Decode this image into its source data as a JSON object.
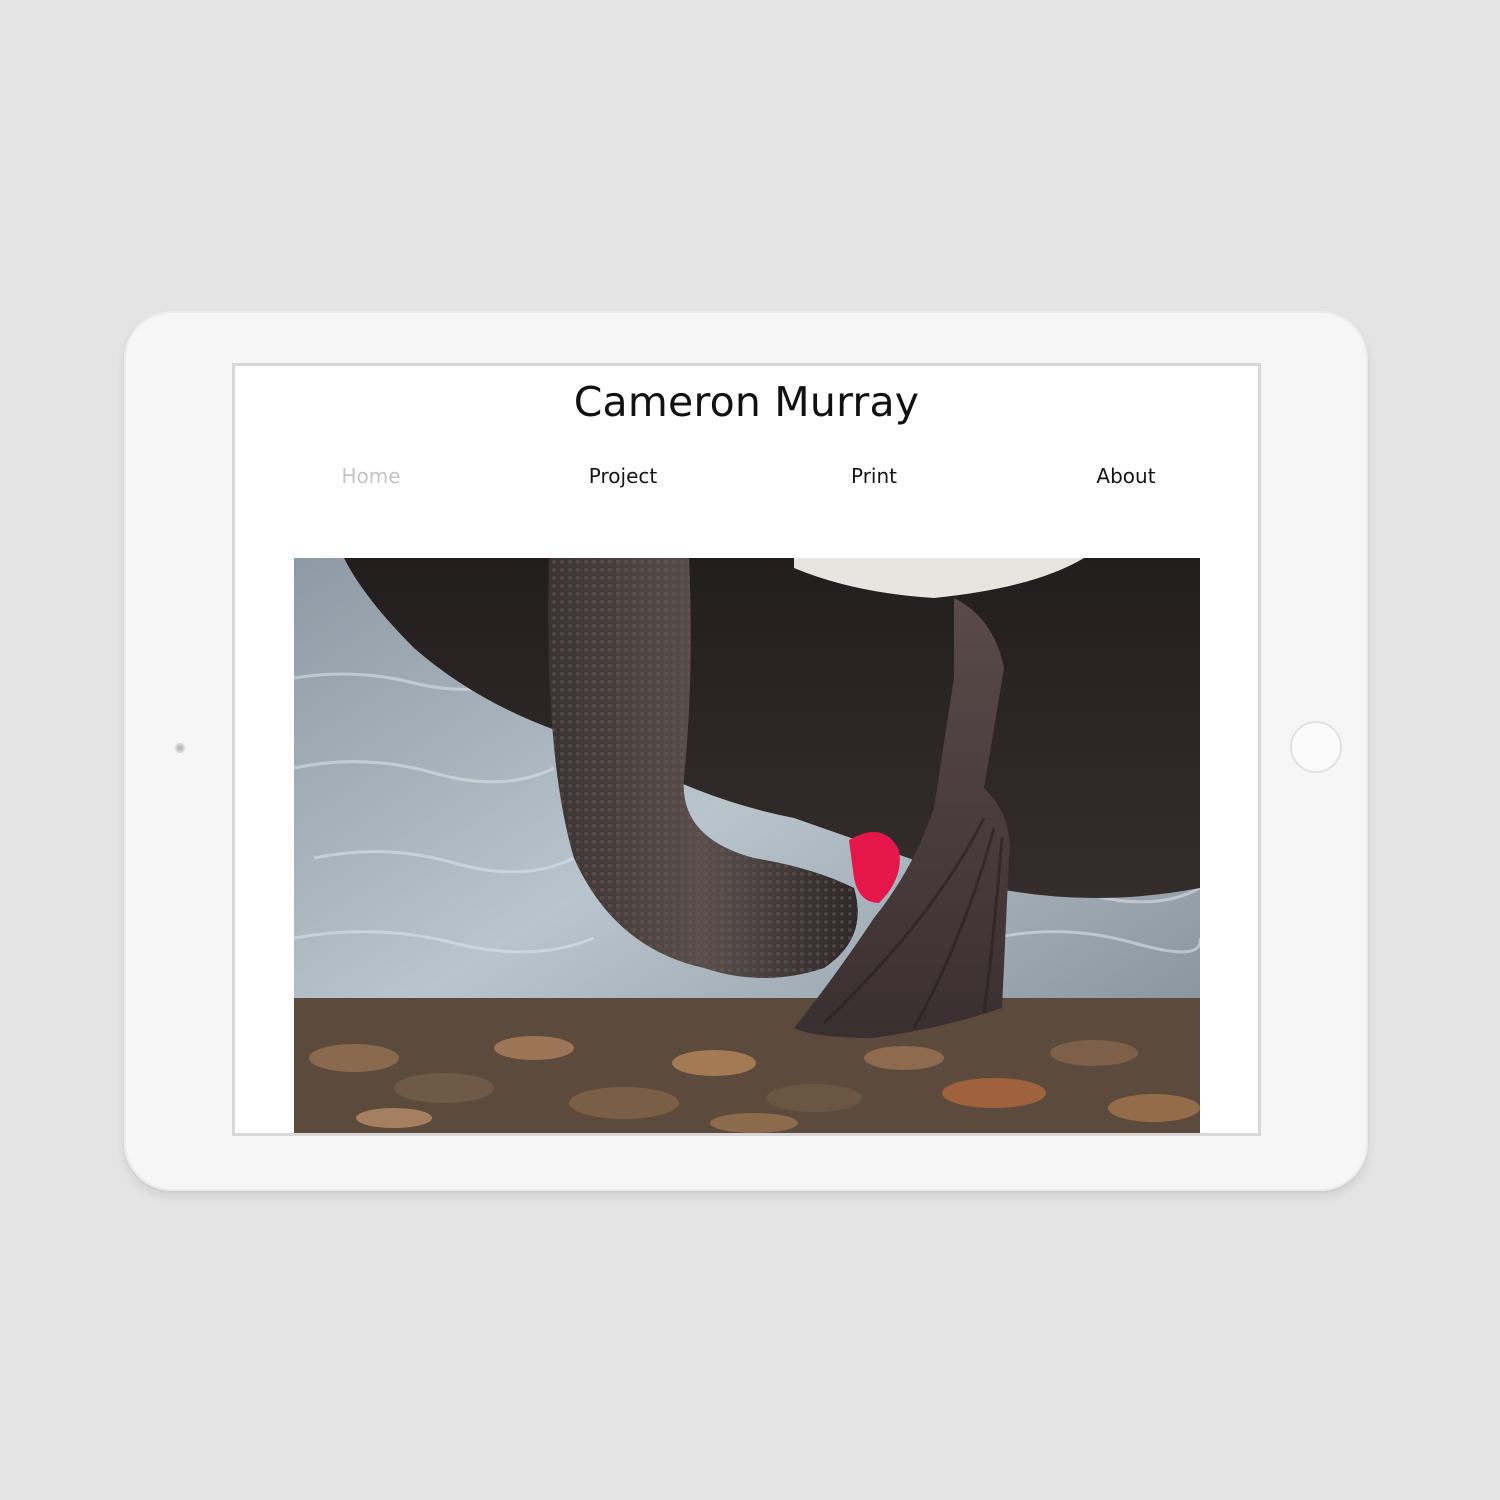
{
  "site": {
    "title": "Cameron Murray"
  },
  "nav": {
    "items": [
      {
        "label": "Home",
        "active": true
      },
      {
        "label": "Project",
        "active": false
      },
      {
        "label": "Print",
        "active": false
      },
      {
        "label": "About",
        "active": false
      }
    ]
  },
  "hero": {
    "subject": "black swan with head under water and foot raised, shallow water over pebbles"
  },
  "colors": {
    "page_bg": "#e4e4e4",
    "device_body": "#f6f6f6",
    "nav_active": "#c4c4c4",
    "nav_text": "#151515",
    "title_text": "#111111",
    "swan_body": "#2c2626",
    "swan_bill": "#e5164a"
  }
}
